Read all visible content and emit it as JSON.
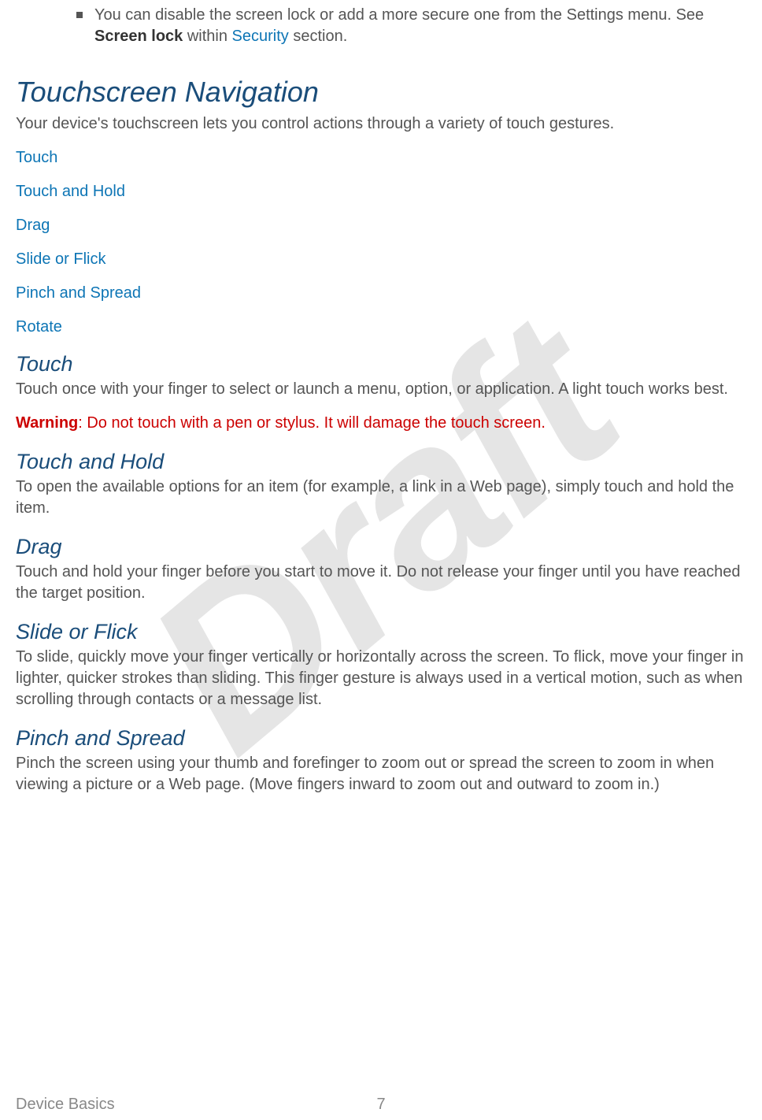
{
  "watermark": "Draft",
  "bullet": {
    "text_before": "You can disable the screen lock or add a more secure one from the Settings menu. See ",
    "bold": "Screen lock",
    "text_mid": " within ",
    "link": "Security",
    "text_after": " section."
  },
  "heading_main": "Touchscreen Navigation",
  "intro": "Your device's touchscreen lets you control actions through a variety of touch gestures.",
  "toc": [
    "Touch",
    "Touch and Hold",
    "Drag",
    "Slide or Flick",
    "Pinch and Spread",
    "Rotate"
  ],
  "sections": {
    "touch": {
      "heading": "Touch",
      "body": "Touch once with your finger to select or launch a menu, option, or application. A light touch works best.",
      "warning_label": "Warning",
      "warning_body": ": Do not touch with a pen or stylus. It will damage the touch screen."
    },
    "touch_hold": {
      "heading": "Touch and Hold",
      "body": "To open the available options for an item (for example, a link in a Web page), simply touch and hold the item."
    },
    "drag": {
      "heading": "Drag",
      "body": "Touch and hold your finger before you start to move it. Do not release your finger until you have reached the target position."
    },
    "slide": {
      "heading": "Slide or Flick",
      "body": "To slide, quickly move your finger vertically or horizontally across the screen. To flick, move your finger in lighter, quicker strokes than sliding. This finger gesture is always used in a vertical motion, such as when scrolling through contacts or a message list."
    },
    "pinch": {
      "heading": "Pinch and Spread",
      "body": "Pinch the screen using your thumb and forefinger to zoom out or spread the screen to zoom in when viewing a picture or a Web page. (Move fingers inward to zoom out and outward to zoom in.)"
    }
  },
  "footer": {
    "section": "Device Basics",
    "page": "7"
  }
}
